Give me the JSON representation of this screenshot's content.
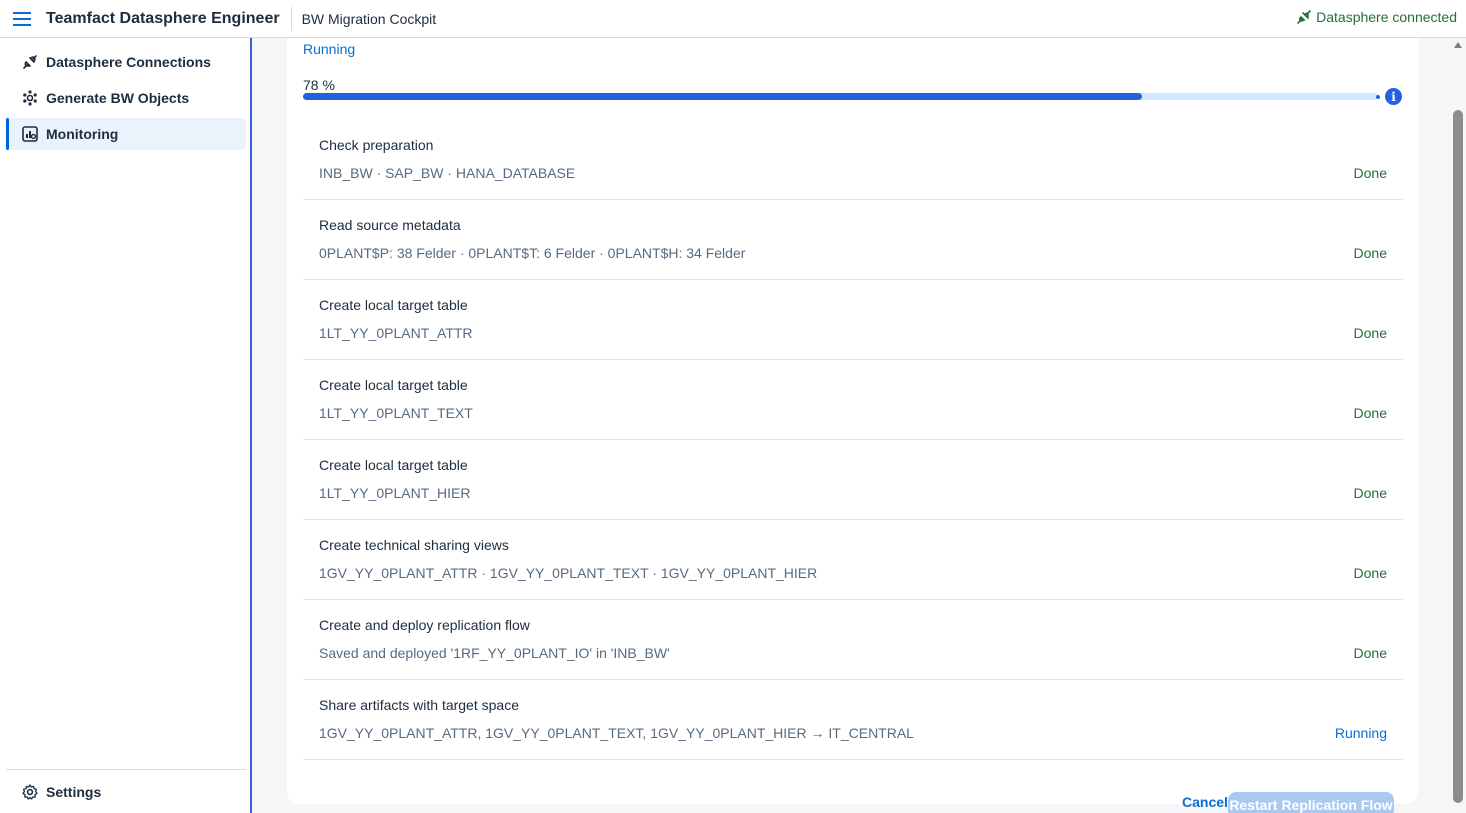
{
  "header": {
    "menu_icon": "hamburger-icon",
    "app_title": "Teamfact Datasphere Engineer",
    "app_subtitle": "BW Migration Cockpit",
    "connection_status": "Datasphere connected",
    "connection_icon": "connection-icon",
    "connection_color": "#256f3a"
  },
  "sidebar": {
    "items": [
      {
        "label": "Datasphere Connections",
        "icon": "connection-icon"
      },
      {
        "label": "Generate BW Objects",
        "icon": "gear-network-icon"
      },
      {
        "label": "Monitoring",
        "icon": "monitor-icon",
        "active": true
      }
    ],
    "settings_label": "Settings",
    "settings_icon": "gear-icon"
  },
  "run": {
    "status": "Running",
    "progress_label": "78 %",
    "progress": 0.78,
    "progress_color": "#2462dd"
  },
  "steps": [
    {
      "title": "Check preparation",
      "detail": "INB_BW · SAP_BW · HANA_DATABASE",
      "status": "Done"
    },
    {
      "title": "Read source metadata",
      "detail": "0PLANT$P: 38 Felder · 0PLANT$T: 6 Felder · 0PLANT$H: 34 Felder",
      "status": "Done"
    },
    {
      "title": "Create local target table",
      "detail": "1LT_YY_0PLANT_ATTR",
      "status": "Done"
    },
    {
      "title": "Create local target table",
      "detail": "1LT_YY_0PLANT_TEXT",
      "status": "Done"
    },
    {
      "title": "Create local target table",
      "detail": "1LT_YY_0PLANT_HIER",
      "status": "Done"
    },
    {
      "title": "Create technical sharing views",
      "detail": "1GV_YY_0PLANT_ATTR · 1GV_YY_0PLANT_TEXT · 1GV_YY_0PLANT_HIER",
      "status": "Done"
    },
    {
      "title": "Create and deploy replication flow",
      "detail": "Saved and deployed '1RF_YY_0PLANT_IO' in 'INB_BW'",
      "status": "Done"
    },
    {
      "title": "Share artifacts with target space",
      "detail": "1GV_YY_0PLANT_ATTR, 1GV_YY_0PLANT_TEXT, 1GV_YY_0PLANT_HIER → IT_CENTRAL",
      "status": "Running"
    }
  ],
  "actions": {
    "cancel_label": "Cancel",
    "restart_label": "Restart Replication Flow"
  },
  "colors": {
    "done": "#256f3a",
    "running": "#0a6ed1",
    "accent": "#0064d9"
  }
}
